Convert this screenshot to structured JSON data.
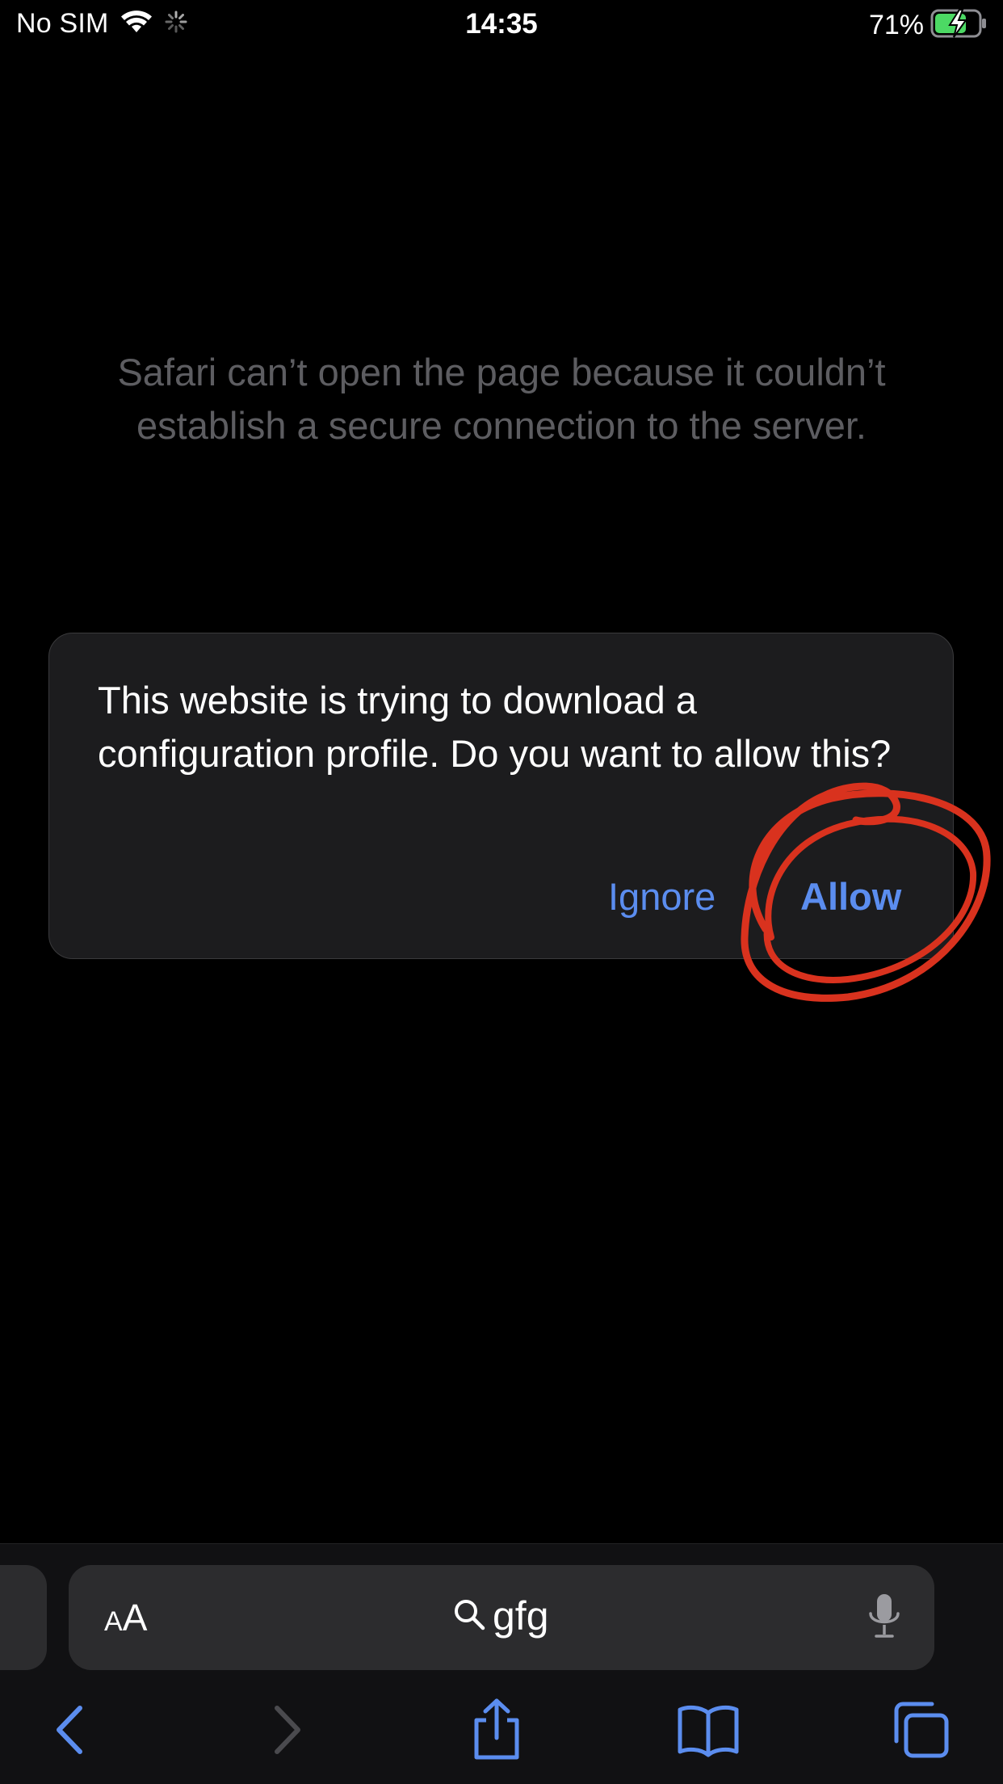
{
  "status_bar": {
    "carrier": "No SIM",
    "time": "14:35",
    "battery_percent": "71%"
  },
  "page": {
    "error_message": "Safari can’t open the page because it couldn’t establish a secure connection to the server."
  },
  "dialog": {
    "message": "This website is trying to download a configuration profile. Do you want to allow this?",
    "ignore_label": "Ignore",
    "allow_label": "Allow"
  },
  "address_bar": {
    "aa_small": "A",
    "aa_large": "A",
    "search_text": "gfg"
  },
  "toolbar": {
    "icons": [
      "back-icon",
      "forward-icon",
      "share-icon",
      "bookmarks-icon",
      "tabs-icon"
    ]
  },
  "colors": {
    "accent": "#5b8def",
    "annotation": "#d9321e",
    "battery": "#4cd964",
    "background": "#000000",
    "dialog": "#1c1c1e"
  }
}
